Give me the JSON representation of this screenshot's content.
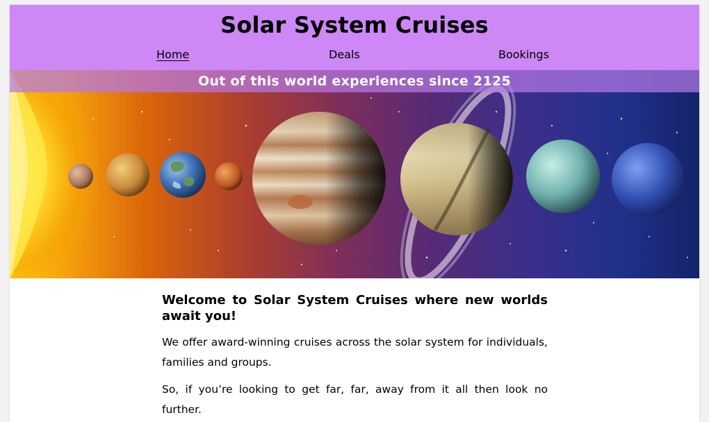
{
  "header": {
    "title": "Solar System Cruises",
    "background_color": "#cd88f5"
  },
  "nav": {
    "items": [
      {
        "label": "Home",
        "active": true
      },
      {
        "label": "Deals",
        "active": false
      },
      {
        "label": "Bookings",
        "active": false
      }
    ]
  },
  "hero": {
    "tagline": "Out of this world experiences since 2125",
    "image_subject": "planets of the solar system lined up beside the sun"
  },
  "main": {
    "heading": "Welcome to Solar System Cruises where new worlds await you!",
    "paragraphs": [
      "We offer award-winning cruises across the solar system for individuals, families and groups.",
      "So, if you’re looking to get far, far, away from it all then look no further."
    ]
  }
}
